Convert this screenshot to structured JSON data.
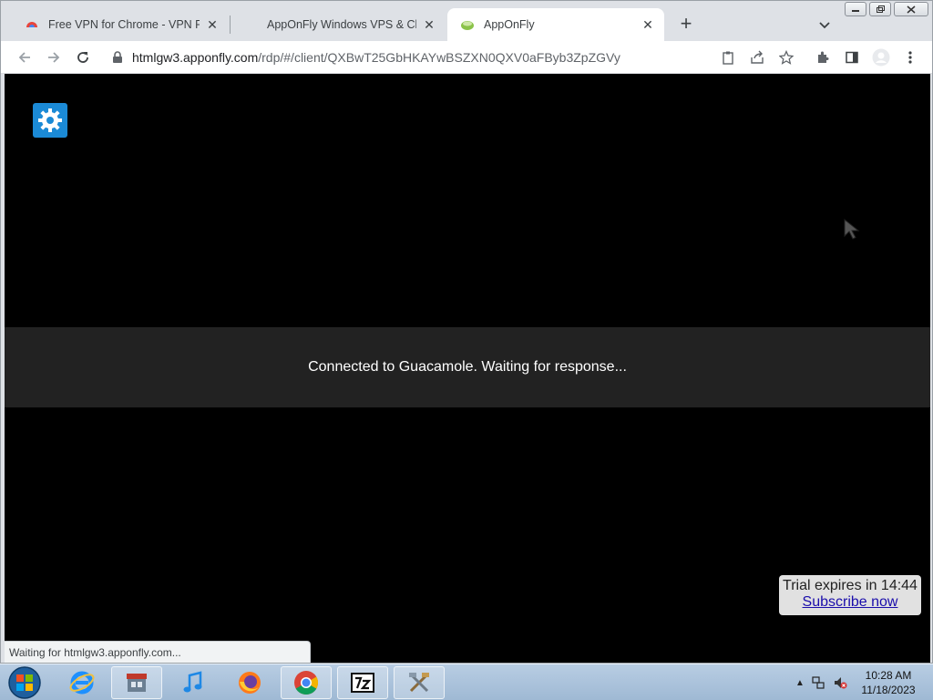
{
  "tabs": [
    {
      "title": "Free VPN for Chrome - VPN Proxy",
      "active": false,
      "favicon": "vpn-icon"
    },
    {
      "title": "AppOnFly Windows VPS & Cloud",
      "active": false,
      "favicon": "apponfly-icon"
    },
    {
      "title": "AppOnFly",
      "active": true,
      "favicon": "apponfly-icon"
    }
  ],
  "address_bar": {
    "host": "htmlgw3.apponfly.com",
    "path": "/rdp/#/client/QXBwT25GbHKAYwBSZXN0QXV0aFByb3ZpZGVy"
  },
  "content": {
    "notification": "Connected to Guacamole. Waiting for response...",
    "trial_text": "Trial expires in 14:44",
    "subscribe_link": "Subscribe now",
    "status_text": "Waiting for htmlgw3.apponfly.com..."
  },
  "taskbar": {
    "items": [
      "internet-explorer-icon",
      "store-icon",
      "itunes-icon",
      "firefox-icon",
      "chrome-icon",
      "7zip-icon",
      "tools-icon"
    ],
    "clock_time": "10:28 AM",
    "clock_date": "11/18/2023"
  },
  "colors": {
    "tab_strip": "#dee1e6",
    "content_bg": "#000000",
    "notification_bg": "#222222",
    "gear_button": "#1b8ad6",
    "link": "#1a0dab"
  }
}
